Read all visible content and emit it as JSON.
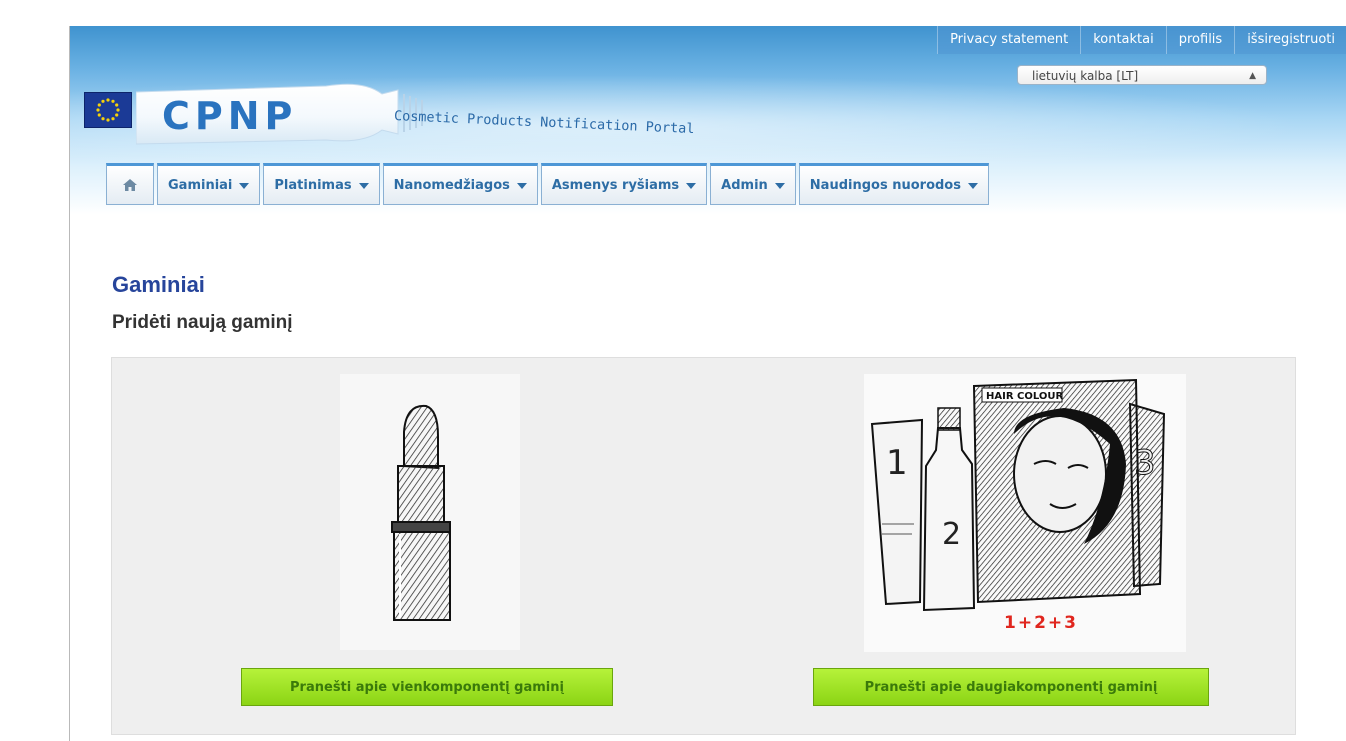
{
  "header": {
    "logo_text": "CPNP",
    "tagline": "Cosmetic Products Notification Portal",
    "top_links": [
      {
        "label": "Privacy statement"
      },
      {
        "label": "kontaktai"
      },
      {
        "label": "profilis"
      },
      {
        "label": "išsiregistruoti"
      }
    ],
    "language_select": {
      "value": "lietuvių kalba [LT]"
    }
  },
  "nav": {
    "home_icon": "home-icon",
    "items": [
      {
        "label": "Gaminiai"
      },
      {
        "label": "Platinimas"
      },
      {
        "label": "Nanomedžiagos"
      },
      {
        "label": "Asmenys ryšiams"
      },
      {
        "label": "Admin"
      },
      {
        "label": "Naudingos nuorodos"
      }
    ]
  },
  "main": {
    "title": "Gaminiai",
    "subtitle": "Pridėti naują gaminį",
    "options": [
      {
        "image": "lipstick-illustration",
        "button_label": "Pranešti apie vienkomponentį gaminį"
      },
      {
        "image": "hair-colour-kit-illustration",
        "image_text": "HAIR COLOUR",
        "numbers": [
          "1",
          "2",
          "3"
        ],
        "caption": "1+2+3",
        "button_label": "Pranešti apie daugiakomponentį gaminį"
      }
    ]
  },
  "colors": {
    "title_blue": "#27459b",
    "nav_text": "#2d6da5",
    "button_green": "#9ee022",
    "caption_red": "#e0261e"
  }
}
